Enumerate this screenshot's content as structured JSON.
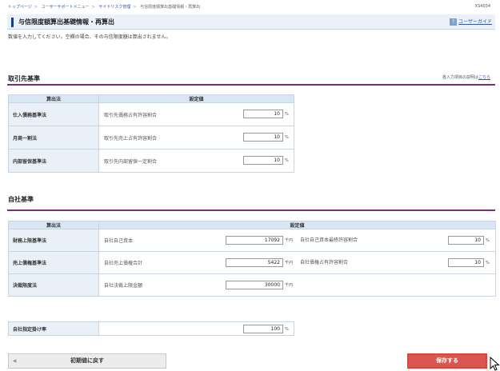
{
  "breadcrumb": {
    "items": [
      "トップページ",
      "ユーザーサポートメニュー",
      "サイドリスク管理",
      "与信限度額算出基礎情報・再算出"
    ]
  },
  "screen_id": "XS4034",
  "page": {
    "title": "与信限度額算出基礎情報・再算出",
    "guide_label": "ユーザーガイド",
    "description": "数値を入力してください。空欄の場合、その与信限度額は算出されません。"
  },
  "help_note": {
    "text": "各入力項目の説明は",
    "link": "こちら"
  },
  "sections": {
    "client": {
      "title": "取引先基準",
      "headers": {
        "method": "算出法",
        "setting": "設定値"
      },
      "rows": [
        {
          "label": "仕入債務基準法",
          "field": "取引先債務占有許容割合",
          "value": "10",
          "unit": "%"
        },
        {
          "label": "月商一割法",
          "field": "取引先売上占有許容割合",
          "value": "10",
          "unit": "%"
        },
        {
          "label": "内部留保基準法",
          "field": "取引先内部留保一定割合",
          "value": "10",
          "unit": "%"
        }
      ]
    },
    "own": {
      "title": "自社基準",
      "headers": {
        "method": "算出法",
        "setting": "設定値"
      },
      "rows": [
        {
          "label": "財務上限基準法",
          "field1": "自社自己資本",
          "value1": "17092",
          "unit1": "千円",
          "field2": "自社自己資本最終許容割合",
          "value2": "10",
          "unit2": "%"
        },
        {
          "label": "売上債権基準法",
          "field1": "自社売上債権合計",
          "value1": "5422",
          "unit1": "千円",
          "field2": "自社債権占有許容割合",
          "value2": "10",
          "unit2": "%"
        },
        {
          "label": "決裁限度法",
          "field1": "自社決裁上限金額",
          "value1": "30000",
          "unit1": "千円"
        }
      ]
    },
    "rate": {
      "label": "自社指定掛け率",
      "value": "100",
      "unit": "%"
    }
  },
  "buttons": {
    "reset": "初期値に戻す",
    "save": "保存する"
  },
  "colors": {
    "accent": "#1a3d8c",
    "section_line": "#7a2f7a",
    "save": "#d8574e",
    "header_bg": "#dbe6f3"
  }
}
